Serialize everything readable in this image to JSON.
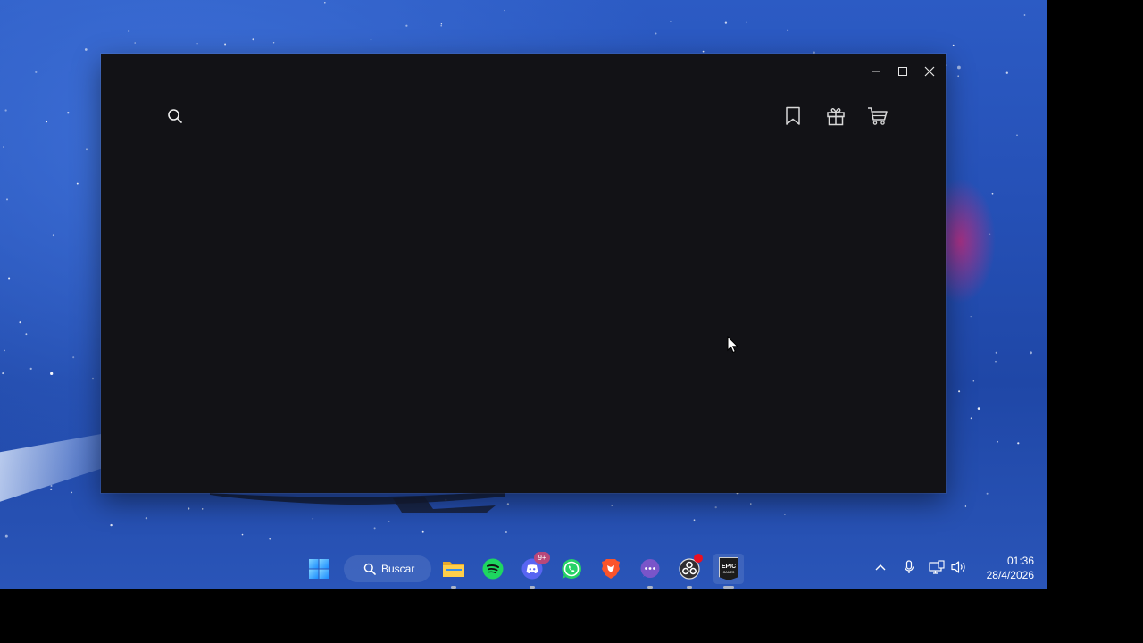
{
  "window": {
    "title": "",
    "controls": {
      "minimize": "minimize-icon",
      "maximize": "maximize-icon",
      "close": "close-icon"
    },
    "toolbar_icons": [
      "search-icon",
      "bookmark-icon",
      "gift-icon",
      "cart-icon"
    ]
  },
  "taskbar": {
    "search_label": "Buscar",
    "apps": [
      {
        "name": "start",
        "icon": "windows-logo-icon"
      },
      {
        "name": "file-explorer",
        "icon": "folder-icon"
      },
      {
        "name": "spotify",
        "icon": "spotify-icon"
      },
      {
        "name": "discord",
        "icon": "discord-icon",
        "badge": "9+"
      },
      {
        "name": "whatsapp",
        "icon": "whatsapp-icon"
      },
      {
        "name": "brave",
        "icon": "brave-icon"
      },
      {
        "name": "chat",
        "icon": "chat-icon"
      },
      {
        "name": "obs",
        "icon": "obs-icon"
      },
      {
        "name": "epic-games",
        "icon": "epic-games-icon",
        "label_line1": "EPIC",
        "label_line2": "GAMES"
      }
    ],
    "tray": {
      "time": "01:36",
      "date": "28/4/2026"
    }
  },
  "colors": {
    "window_bg": "#121216",
    "desktop_blue": "#2550b6",
    "spotify": "#1ed760",
    "whatsapp": "#25d366",
    "discord": "#5865f2",
    "brave": "#fb542b",
    "badge_red": "#e81123"
  }
}
